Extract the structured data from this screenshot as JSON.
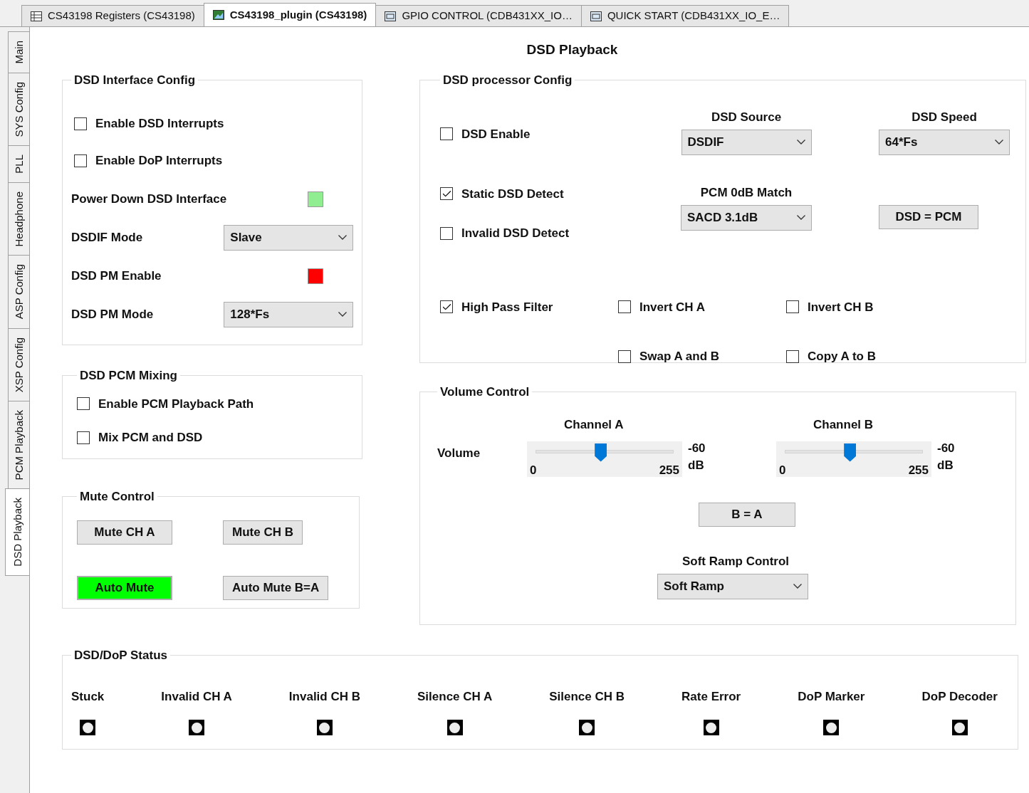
{
  "document_tabs": [
    {
      "label": "CS43198 Registers (CS43198)",
      "kind": "table",
      "selected": false
    },
    {
      "label": "CS43198_plugin (CS43198)",
      "kind": "plugin",
      "selected": true
    },
    {
      "label": "GPIO CONTROL (CDB431XX_IO…",
      "kind": "window",
      "selected": false
    },
    {
      "label": "QUICK START (CDB431XX_IO_E…",
      "kind": "window",
      "selected": false
    }
  ],
  "side_tabs": [
    {
      "label": "Main",
      "selected": false
    },
    {
      "label": "SYS Config",
      "selected": false
    },
    {
      "label": "PLL",
      "selected": false
    },
    {
      "label": "Headphone",
      "selected": false
    },
    {
      "label": "ASP Config",
      "selected": false
    },
    {
      "label": "XSP Config",
      "selected": false
    },
    {
      "label": "PCM Playback",
      "selected": false
    },
    {
      "label": "DSD Playback",
      "selected": true
    }
  ],
  "page_title": "DSD Playback",
  "interface_config": {
    "title": "DSD Interface Config",
    "items": [
      {
        "kind": "checkbox",
        "label": "Enable DSD Interrupts",
        "checked": false
      },
      {
        "kind": "checkbox",
        "label": "Enable DoP Interrupts",
        "checked": false
      },
      {
        "kind": "indicator",
        "label": "Power Down DSD Interface",
        "color": "#90ee90"
      },
      {
        "kind": "dropdown",
        "label": "DSDIF Mode",
        "value": "Slave"
      },
      {
        "kind": "indicator",
        "label": "DSD PM Enable",
        "color": "#ff0000"
      },
      {
        "kind": "dropdown",
        "label": "DSD PM Mode",
        "value": "128*Fs"
      }
    ]
  },
  "pcm_mixing": {
    "title": "DSD PCM Mixing",
    "items": [
      {
        "label": "Enable PCM Playback Path",
        "checked": false
      },
      {
        "label": "Mix PCM and DSD",
        "checked": false
      }
    ]
  },
  "mute_control": {
    "title": "Mute Control",
    "buttons": [
      {
        "label": "Mute CH A",
        "on": false
      },
      {
        "label": "Mute CH B",
        "on": false
      },
      {
        "label": "Auto Mute",
        "on": true
      },
      {
        "label": "Auto Mute B=A",
        "on": false
      }
    ]
  },
  "processor_config": {
    "title": "DSD processor Config",
    "dsd_enable": {
      "label": "DSD Enable",
      "checked": false
    },
    "dsd_source": {
      "label": "DSD Source",
      "value": "DSDIF"
    },
    "dsd_speed": {
      "label": "DSD Speed",
      "value": "64*Fs"
    },
    "detects": [
      {
        "label": "Static DSD Detect",
        "checked": true
      },
      {
        "label": "Invalid DSD Detect",
        "checked": false
      }
    ],
    "pcm_match": {
      "label": "PCM 0dB Match",
      "value": "SACD 3.1dB"
    },
    "dsd_pcm_button": "DSD = PCM",
    "filters": [
      {
        "label": "High Pass Filter",
        "checked": true
      },
      {
        "label": "Invert CH A",
        "checked": false
      },
      {
        "label": "Invert CH B",
        "checked": false
      },
      {
        "label": "Swap A and B",
        "checked": false
      },
      {
        "label": "Copy A to B",
        "checked": false
      }
    ]
  },
  "volume_control": {
    "title": "Volume Control",
    "row_label": "Volume",
    "channels": [
      {
        "name": "Channel A",
        "level": 0.47,
        "min": "0",
        "max": "255",
        "reading": "-60",
        "unit": "dB"
      },
      {
        "name": "Channel B",
        "level": 0.47,
        "min": "0",
        "max": "255",
        "reading": "-60",
        "unit": "dB"
      }
    ],
    "copy_button": "B = A",
    "ramp_label": "Soft Ramp Control",
    "ramp_value": "Soft Ramp"
  },
  "status": {
    "title": "DSD/DoP Status",
    "leds": [
      {
        "label": "Stuck",
        "on": false
      },
      {
        "label": "Invalid CH A",
        "on": false
      },
      {
        "label": "Invalid CH B",
        "on": false
      },
      {
        "label": "Silence CH A",
        "on": false
      },
      {
        "label": "Silence CH B",
        "on": false
      },
      {
        "label": "Rate Error",
        "on": false
      },
      {
        "label": "DoP Marker",
        "on": false
      },
      {
        "label": "DoP Decoder",
        "on": false
      }
    ]
  }
}
